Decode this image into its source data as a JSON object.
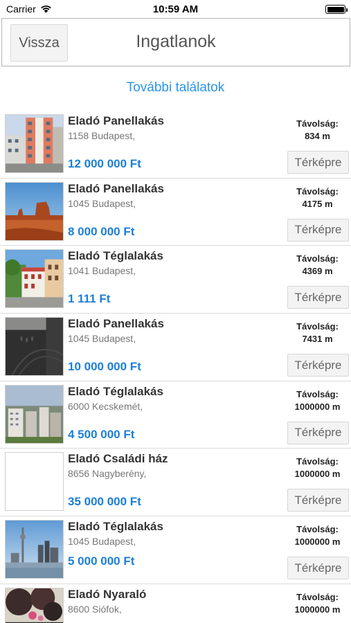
{
  "status_bar": {
    "carrier": "Carrier",
    "time": "10:59 AM"
  },
  "navbar": {
    "back_label": "Vissza",
    "title": "Ingatlanok"
  },
  "more_results": "További találatok",
  "distance_label": "Távolság:",
  "map_button_label": "Térképre",
  "listings": [
    {
      "title": "Eladó Panellakás",
      "address": "1158 Budapest,",
      "price": "12 000 000 Ft",
      "distance": "834 m",
      "image": "building-photo"
    },
    {
      "title": "Eladó Panellakás",
      "address": "1045 Budapest,",
      "price": "8 000 000 Ft",
      "distance": "4175 m",
      "image": "desert-photo"
    },
    {
      "title": "Eladó Téglalakás",
      "address": "1041 Budapest,",
      "price": "1 111 Ft",
      "distance": "4369 m",
      "image": "street-photo"
    },
    {
      "title": "Eladó Panellakás",
      "address": "1045 Budapest,",
      "price": "10 000 000 Ft",
      "distance": "7431 m",
      "image": "dark-wall-photo"
    },
    {
      "title": "Eladó Téglalakás",
      "address": "6000 Kecskemét,",
      "price": "4 500 000 Ft",
      "distance": "1000000 m",
      "image": "city-photo"
    },
    {
      "title": "Eladó Családi ház",
      "address": "8656 Nagyberény,",
      "price": "35 000 000 Ft",
      "distance": "1000000 m",
      "image": "empty-photo"
    },
    {
      "title": "Eladó Téglalakás",
      "address": "1045 Budapest,",
      "price": "5 000 000 Ft",
      "distance": "1000000 m",
      "image": "skyline-photo"
    },
    {
      "title": "Eladó Nyaraló",
      "address": "8600 Siófok,",
      "price": "",
      "distance": "1000000 m",
      "image": "tree-photo"
    }
  ]
}
